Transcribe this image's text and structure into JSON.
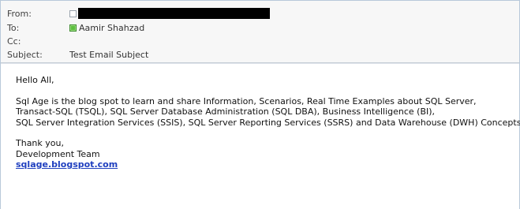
{
  "header": {
    "from_label": "From:",
    "to_label": "To:",
    "cc_label": "Cc:",
    "subject_label": "Subject:",
    "to_value": "Aamir Shahzad",
    "subject_value": "Test Email Subject"
  },
  "body": {
    "greeting": "Hello All,",
    "paragraph_lines": [
      "Sql Age is the blog spot to learn and share Information, Scenarios, Real Time Examples about SQL Server,",
      "Transact-SQL (TSQL), SQL Server Database Administration (SQL DBA), Business Intelligence (BI),",
      "SQL Server Integration Services (SSIS), SQL Server Reporting Services (SSRS) and Data Warehouse (DWH) Concepts."
    ],
    "closing": "Thank you,",
    "signature": "Development Team",
    "link": "sqlage.blogspot.com"
  },
  "icons": {
    "from_presence": "presence-unknown-icon",
    "to_presence": "presence-online-icon"
  },
  "colors": {
    "header_background": "#f7f7f7",
    "presence_online": "#5cbf3f",
    "link": "#1f3fbf"
  }
}
